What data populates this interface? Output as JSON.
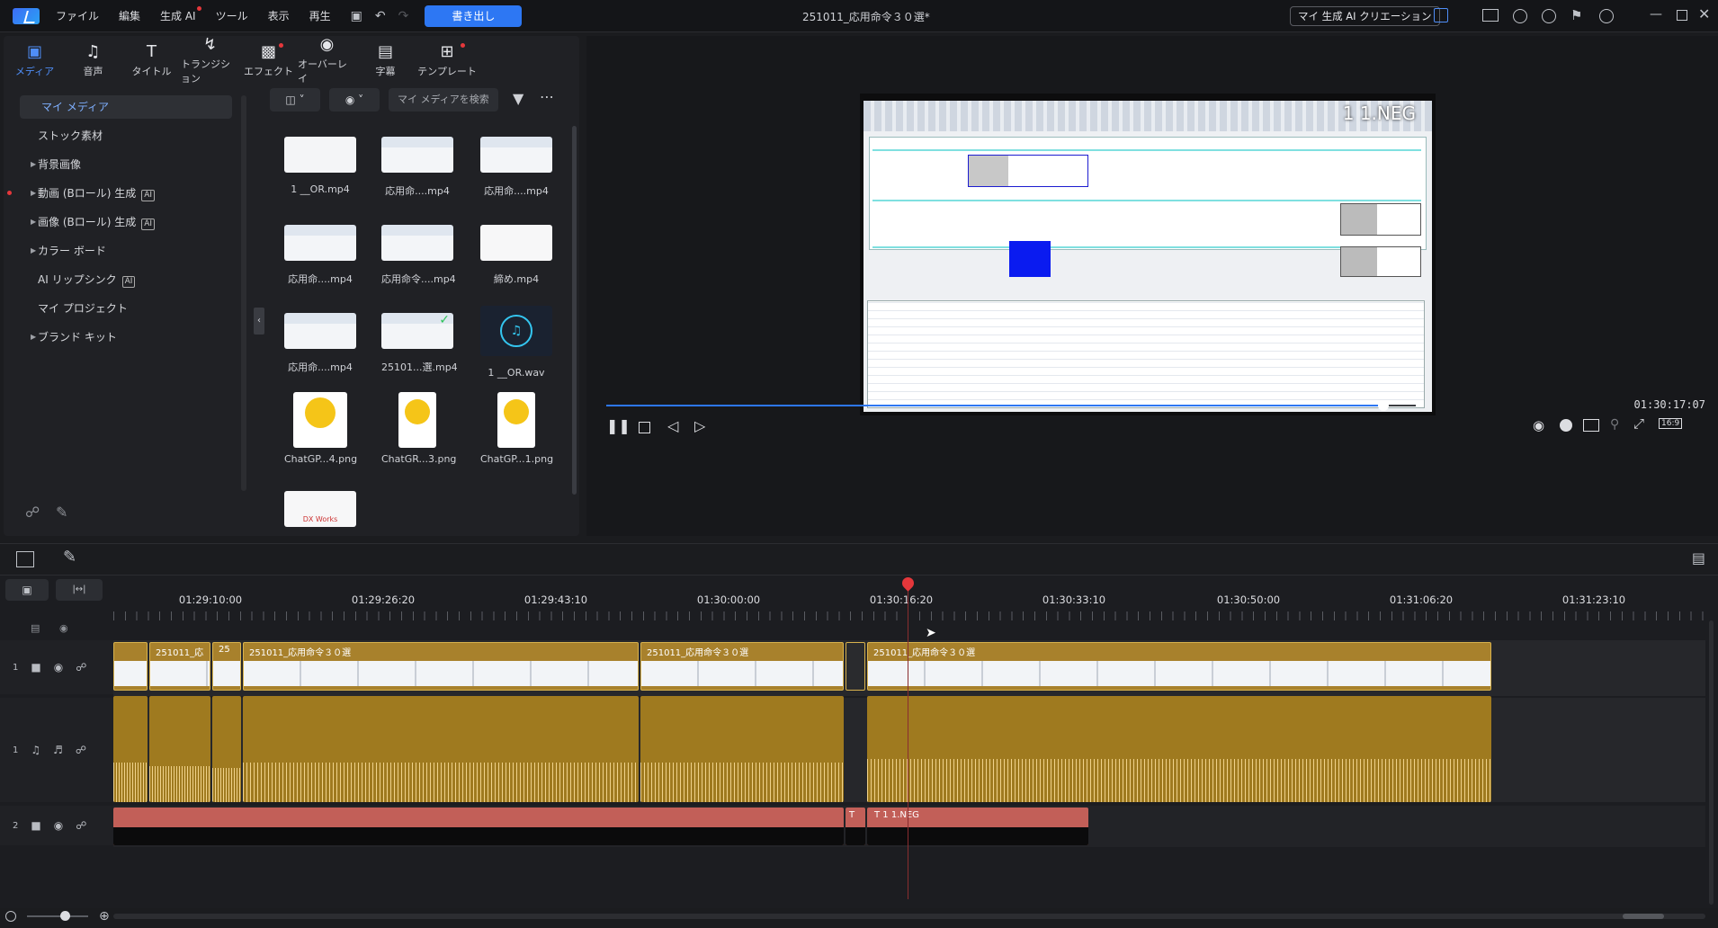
{
  "menu": [
    "ファイル",
    "編集",
    "生成 AI",
    "ツール",
    "表示",
    "再生"
  ],
  "export_label": "書き出し",
  "project_title": "251011_応用命令３０選*",
  "ai_creation_label": "マイ 生成 AI クリエーション",
  "tabs": [
    {
      "label": "メディア",
      "icon": "media-icon"
    },
    {
      "label": "音声",
      "icon": "music-icon"
    },
    {
      "label": "タイトル",
      "icon": "title-icon"
    },
    {
      "label": "トランジション",
      "icon": "transition-icon"
    },
    {
      "label": "エフェクト",
      "icon": "effect-icon"
    },
    {
      "label": "オーバーレイ",
      "icon": "overlay-icon"
    },
    {
      "label": "字幕",
      "icon": "subtitle-icon"
    },
    {
      "label": "テンプレート",
      "icon": "template-icon"
    }
  ],
  "tree": [
    {
      "label": "マイ メディア"
    },
    {
      "label": "ストック素材"
    },
    {
      "label": "背景画像"
    },
    {
      "label": "動画 (Bロール) 生成"
    },
    {
      "label": "画像 (Bロール) 生成"
    },
    {
      "label": "カラー ボード"
    },
    {
      "label": "AI リップシンク"
    },
    {
      "label": "マイ プロジェクト"
    },
    {
      "label": "ブランド キット"
    }
  ],
  "search_placeholder": "マイ メディアを検索",
  "media": [
    {
      "label": "1 __OR.mp4"
    },
    {
      "label": "応用命....mp4"
    },
    {
      "label": "応用命....mp4"
    },
    {
      "label": "応用命....mp4"
    },
    {
      "label": "応用命令....mp4"
    },
    {
      "label": "締め.mp4"
    },
    {
      "label": "応用命....mp4"
    },
    {
      "label": "25101...選.mp4"
    },
    {
      "label": "1 __OR.wav"
    },
    {
      "label": "ChatGP...4.png"
    },
    {
      "label": "ChatGR...3.png"
    },
    {
      "label": "ChatGP...1.png"
    },
    {
      "label": "DX Works"
    }
  ],
  "preview_overlay_text": "1 1.NEG",
  "timecode": "01:30:17:07",
  "playback_progress": 0.96,
  "aspect_label": "16:9",
  "ruler_labels": [
    "01:29:10:00",
    "01:29:26:20",
    "01:29:43:10",
    "01:30:00:00",
    "01:30:16:20",
    "01:30:33:10",
    "01:30:50:00",
    "01:31:06:20",
    "01:31:23:10"
  ],
  "tracks": [
    {
      "num": "1",
      "kind": "video"
    },
    {
      "num": "1",
      "kind": "audio"
    },
    {
      "num": "2",
      "kind": "video"
    }
  ],
  "video_clips": [
    {
      "label": ""
    },
    {
      "label": "251011_応"
    },
    {
      "label": "25"
    },
    {
      "label": "251011_応用命令３０選"
    },
    {
      "label": "251011_応用命令３０選"
    },
    {
      "label": ""
    },
    {
      "label": "251011_応用命令３０選"
    }
  ],
  "title_clips": [
    {
      "label": ""
    },
    {
      "label": "T"
    },
    {
      "label": "T  1 1.NEG"
    }
  ],
  "colors": {
    "accent": "#2d77f3",
    "video_clip": "#a8812c",
    "audio_clip": "#9f7a1f",
    "title_clip": "#c25f58",
    "playhead": "#e5373b"
  }
}
